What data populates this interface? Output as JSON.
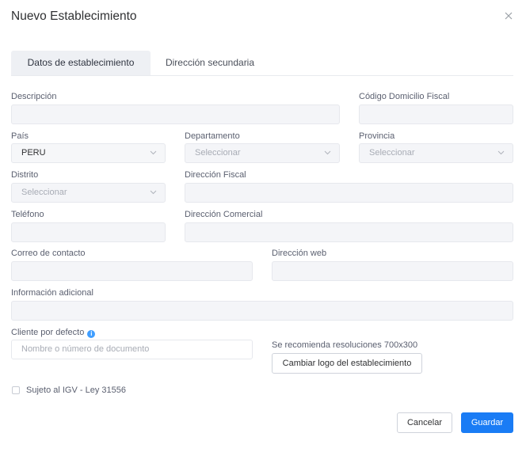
{
  "dialog": {
    "title": "Nuevo Establecimiento",
    "close_icon": "close-icon"
  },
  "tabs": [
    {
      "label": "Datos de establecimiento",
      "active": true
    },
    {
      "label": "Dirección secundaria",
      "active": false
    }
  ],
  "form": {
    "descripcion": {
      "label": "Descripción",
      "value": ""
    },
    "codigo_domicilio_fiscal": {
      "label": "Código Domicilio Fiscal",
      "value": ""
    },
    "pais": {
      "label": "País",
      "value": "PERU"
    },
    "departamento": {
      "label": "Departamento",
      "placeholder": "Seleccionar"
    },
    "provincia": {
      "label": "Provincia",
      "placeholder": "Seleccionar"
    },
    "distrito": {
      "label": "Distrito",
      "placeholder": "Seleccionar"
    },
    "direccion_fiscal": {
      "label": "Dirección Fiscal",
      "value": ""
    },
    "telefono": {
      "label": "Teléfono",
      "value": ""
    },
    "direccion_comercial": {
      "label": "Dirección Comercial",
      "value": ""
    },
    "correo_contacto": {
      "label": "Correo de contacto",
      "value": ""
    },
    "direccion_web": {
      "label": "Dirección web",
      "value": ""
    },
    "informacion_adicional": {
      "label": "Información adicional",
      "value": ""
    },
    "cliente_por_defecto": {
      "label": "Cliente por defecto",
      "placeholder": "Nombre o número de documento",
      "info_icon": "i"
    },
    "logo_hint": "Se recomienda resoluciones 700x300",
    "logo_button": "Cambiar logo del establecimiento",
    "igv_checkbox": {
      "label": "Sujeto al IGV - Ley 31556",
      "checked": false
    }
  },
  "footer": {
    "cancel": "Cancelar",
    "save": "Guardar"
  },
  "colors": {
    "primary": "#1a7cf5",
    "info": "#409eff"
  }
}
